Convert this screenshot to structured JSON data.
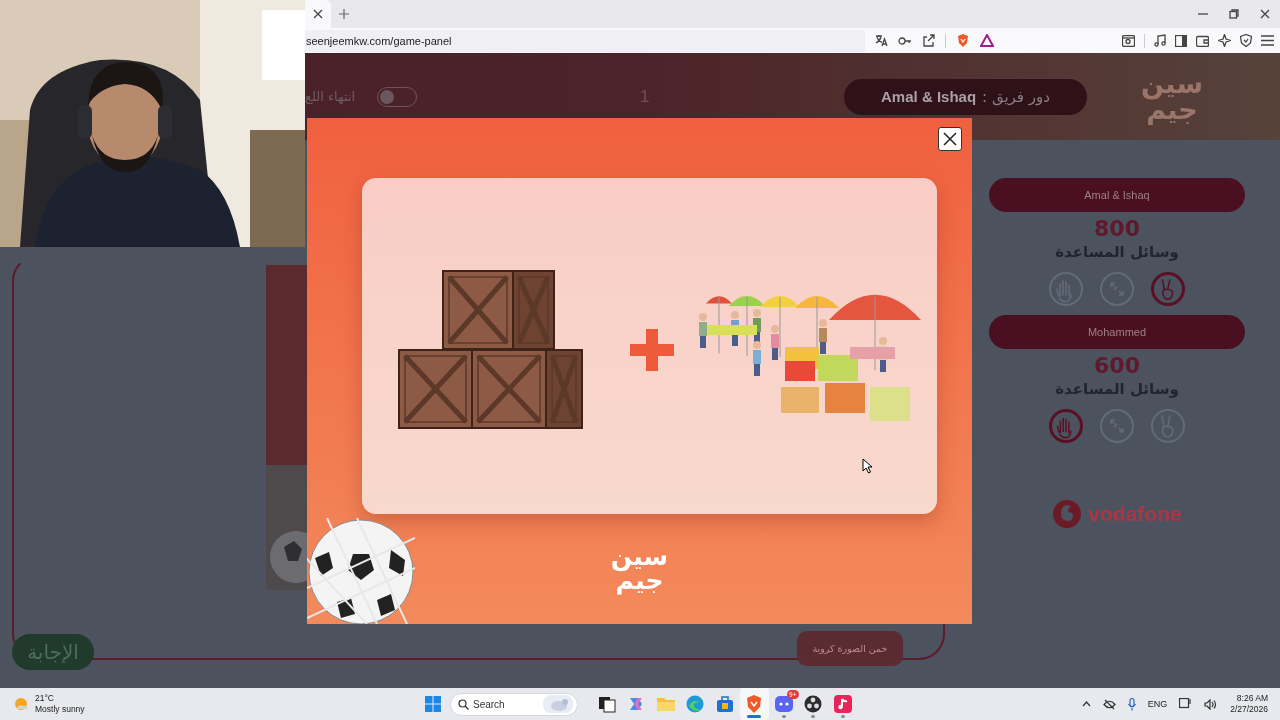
{
  "browser": {
    "url": "seenjeemkw.com/game-panel"
  },
  "header": {
    "end_game_label": "انتهاء اللع",
    "end_game_toggle": {
      "on": false
    },
    "round": "1",
    "turn": {
      "label": "دور فريق :",
      "team": "Amal & Ishaq"
    },
    "logo": "سين جيم"
  },
  "teams": [
    {
      "name": "Amal & Ishaq",
      "score": "800",
      "aids_label": "وسائل المساعدة",
      "aids": [
        {
          "kind": "hand",
          "active": false
        },
        {
          "kind": "swap",
          "active": false
        },
        {
          "kind": "peace",
          "active": true
        }
      ]
    },
    {
      "name": "Mohammed",
      "score": "600",
      "aids_label": "وسائل المساعدة",
      "aids": [
        {
          "kind": "hand",
          "active": true
        },
        {
          "kind": "swap",
          "active": false
        },
        {
          "kind": "peace",
          "active": false
        }
      ]
    }
  ],
  "sponsor": "vodafone",
  "board": {
    "answer_button": "الإجابة",
    "hint_button": "خمن الصورة كروية"
  },
  "modal": {
    "logo": "سين جيم"
  },
  "taskbar": {
    "weather": {
      "temperature": "21°C",
      "condition": "Mostly sunny"
    },
    "search": {
      "placeholder": "Search"
    },
    "apps": [
      {
        "kind": "task-view",
        "selected": false,
        "running": false
      },
      {
        "kind": "copilot",
        "selected": false,
        "running": false
      },
      {
        "kind": "folder",
        "selected": false,
        "running": false
      },
      {
        "kind": "edge",
        "selected": false,
        "running": false
      },
      {
        "kind": "store",
        "selected": false,
        "running": false
      },
      {
        "kind": "brave",
        "selected": true,
        "running": true
      },
      {
        "kind": "discord",
        "selected": false,
        "running": true,
        "badge": "9+"
      },
      {
        "kind": "obs",
        "selected": false,
        "running": true
      },
      {
        "kind": "video",
        "selected": false,
        "running": true
      }
    ],
    "language": "ENG",
    "time": "8:26 AM",
    "date": "2/27/2026"
  }
}
